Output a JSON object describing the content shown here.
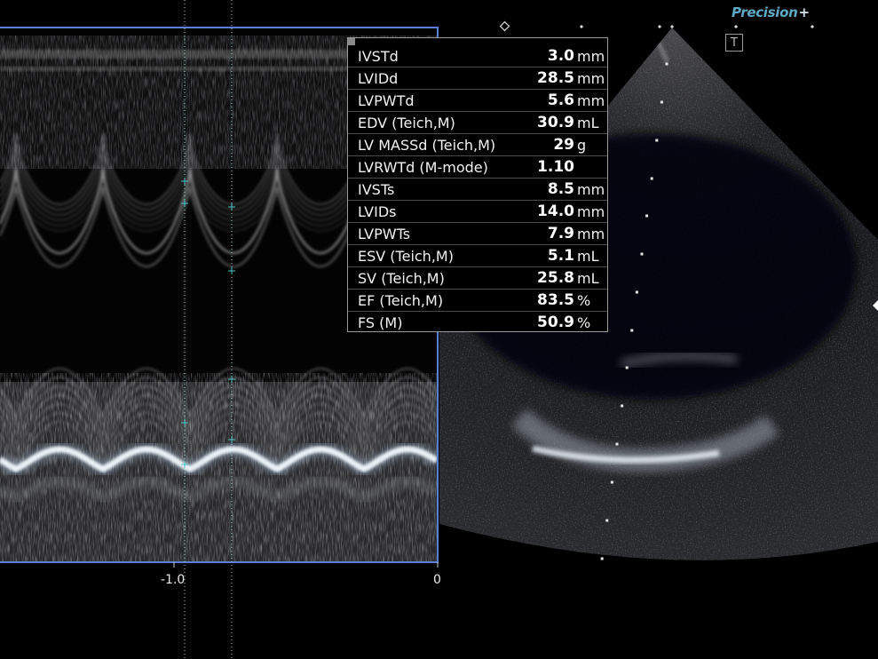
{
  "brand": {
    "name": "Precision",
    "suffix": "+"
  },
  "toolbar": {
    "text_tool_icon": "T"
  },
  "axis": {
    "ticks": [
      {
        "label": "-1.0"
      },
      {
        "label": "0"
      }
    ]
  },
  "measurements": [
    {
      "label": "IVSTd",
      "value": "3.0",
      "unit": "mm"
    },
    {
      "label": "LVIDd",
      "value": "28.5",
      "unit": "mm"
    },
    {
      "label": "LVPWTd",
      "value": "5.6",
      "unit": "mm"
    },
    {
      "label": "EDV (Teich,M)",
      "value": "30.9",
      "unit": "mL"
    },
    {
      "label": "LV MASSd (Teich,M)",
      "value": "29",
      "unit": "g"
    },
    {
      "label": "LVRWTd (M-mode)",
      "value": "1.10",
      "unit": ""
    },
    {
      "label": "IVSTs",
      "value": "8.5",
      "unit": "mm"
    },
    {
      "label": "LVIDs",
      "value": "14.0",
      "unit": "mm"
    },
    {
      "label": "LVPWTs",
      "value": "7.9",
      "unit": "mm"
    },
    {
      "label": "ESV (Teich,M)",
      "value": "5.1",
      "unit": "mL"
    },
    {
      "label": "SV (Teich,M)",
      "value": "25.8",
      "unit": "mL"
    },
    {
      "label": "EF (Teich,M)",
      "value": "83.5",
      "unit": "%"
    },
    {
      "label": "FS (M)",
      "value": "50.9",
      "unit": "%"
    }
  ],
  "colors": {
    "frame": "#5a7fd6",
    "caliper": "#4fc6c6",
    "panel_border": "#9a9a9a",
    "brand": "#5fa9c4"
  }
}
